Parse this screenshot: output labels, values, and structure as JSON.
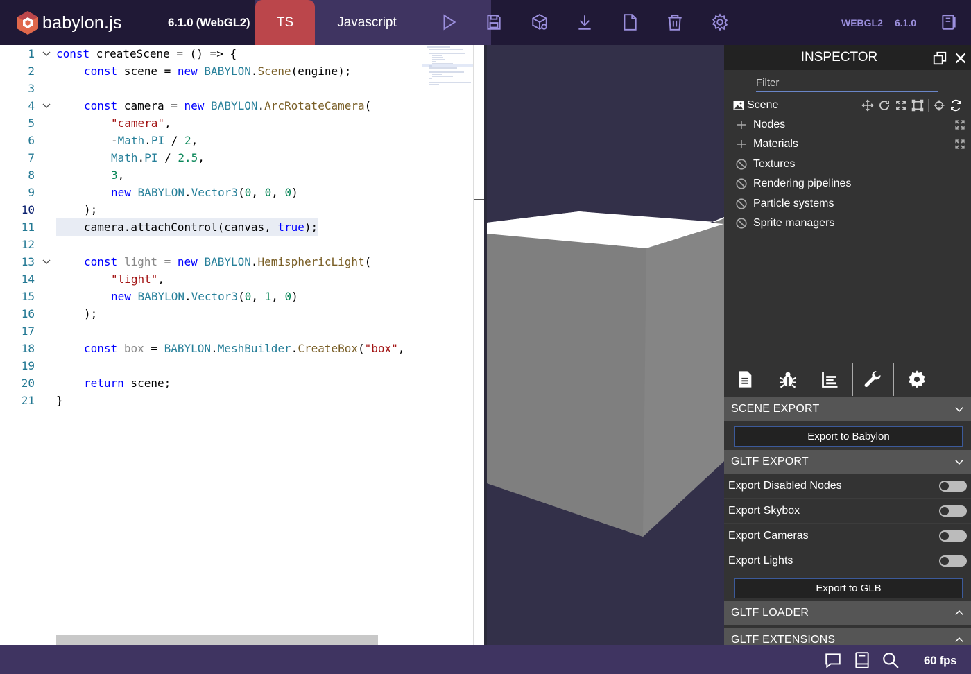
{
  "header": {
    "logo_text": "babylon.js",
    "version_label": "6.1.0 (WebGL2)",
    "tab_ts": "TS",
    "tab_js": "Javascript",
    "engine_label": "WEBGL2",
    "version_short": "6.1.0",
    "icons": [
      "play-icon",
      "save-icon",
      "inspector-cube-icon",
      "download-icon",
      "new-file-icon",
      "delete-icon",
      "settings-icon",
      "examples-icon"
    ]
  },
  "editor": {
    "lines": [
      {
        "n": "1",
        "fold": true
      },
      {
        "n": "2",
        "fold": false
      },
      {
        "n": "3",
        "fold": false
      },
      {
        "n": "4",
        "fold": true
      },
      {
        "n": "5",
        "fold": false
      },
      {
        "n": "6",
        "fold": false
      },
      {
        "n": "7",
        "fold": false
      },
      {
        "n": "8",
        "fold": false
      },
      {
        "n": "9",
        "fold": false
      },
      {
        "n": "10",
        "fold": false
      },
      {
        "n": "11",
        "fold": false
      },
      {
        "n": "12",
        "fold": false
      },
      {
        "n": "13",
        "fold": true
      },
      {
        "n": "14",
        "fold": false
      },
      {
        "n": "15",
        "fold": false
      },
      {
        "n": "16",
        "fold": false
      },
      {
        "n": "17",
        "fold": false
      },
      {
        "n": "18",
        "fold": false
      },
      {
        "n": "19",
        "fold": false
      },
      {
        "n": "20",
        "fold": false
      },
      {
        "n": "21",
        "fold": false
      }
    ],
    "code": {
      "l1": [
        "const",
        " createScene = () => {"
      ],
      "l2": [
        "const",
        " scene = ",
        "new",
        " ",
        "BABYLON",
        ".",
        "Scene",
        "(engine);"
      ],
      "l4": [
        "const",
        " camera = ",
        "new",
        " ",
        "BABYLON",
        ".",
        "ArcRotateCamera",
        "("
      ],
      "l5": [
        "\"camera\"",
        ","
      ],
      "l6": [
        "-",
        "Math",
        ".",
        "PI",
        " / ",
        "2",
        ","
      ],
      "l7": [
        "Math",
        ".",
        "PI",
        " / ",
        "2.5",
        ","
      ],
      "l8": [
        "3",
        ","
      ],
      "l9": [
        "new",
        " ",
        "BABYLON",
        ".",
        "Vector3",
        "(",
        "0",
        ", ",
        "0",
        ", ",
        "0",
        ")"
      ],
      "l10": [
        ");"
      ],
      "l11": [
        "camera.attachControl(canvas, ",
        "true",
        ");"
      ],
      "l13": [
        "const",
        " ",
        "light",
        " = ",
        "new",
        " ",
        "BABYLON",
        ".",
        "HemisphericLight",
        "("
      ],
      "l14": [
        "\"light\"",
        ","
      ],
      "l15": [
        "new",
        " ",
        "BABYLON",
        ".",
        "Vector3",
        "(",
        "0",
        ", ",
        "1",
        ", ",
        "0",
        ")"
      ],
      "l16": [
        ");"
      ],
      "l18": [
        "const",
        " ",
        "box",
        " = ",
        "BABYLON",
        ".",
        "MeshBuilder",
        ".",
        "CreateBox",
        "(",
        "\"box\"",
        ","
      ],
      "l20": [
        "return",
        " scene;"
      ],
      "l21": [
        "}"
      ]
    }
  },
  "inspector": {
    "title": "INSPECTOR",
    "filter_placeholder": "Filter",
    "tree": [
      {
        "label": "Scene",
        "icon": "image-icon"
      },
      {
        "label": "Nodes",
        "icon": "plus-icon"
      },
      {
        "label": "Materials",
        "icon": "plus-icon"
      },
      {
        "label": "Textures",
        "icon": "ban-icon"
      },
      {
        "label": "Rendering pipelines",
        "icon": "ban-icon"
      },
      {
        "label": "Particle systems",
        "icon": "ban-icon"
      },
      {
        "label": "Sprite managers",
        "icon": "ban-icon"
      }
    ],
    "tabs": [
      "properties-icon",
      "debug-icon",
      "statistics-icon",
      "tools-icon",
      "settings-icon"
    ],
    "active_tab": "tools-icon",
    "sections": {
      "scene_export": "SCENE EXPORT",
      "export_babylon": "Export to Babylon",
      "gltf_export": "GLTF EXPORT",
      "toggles": [
        {
          "label": "Export Disabled Nodes",
          "on": false
        },
        {
          "label": "Export Skybox",
          "on": false
        },
        {
          "label": "Export Cameras",
          "on": false
        },
        {
          "label": "Export Lights",
          "on": false
        }
      ],
      "export_glb": "Export to GLB",
      "gltf_loader": "GLTF LOADER",
      "gltf_extensions": "GLTF EXTENSIONS"
    }
  },
  "footer": {
    "fps": "60 fps",
    "icons": [
      "feedback-icon",
      "docs-icon",
      "search-icon"
    ]
  },
  "colors": {
    "topbar": "#201936",
    "ts_tab": "#bb464b",
    "lang_bg": "#3f3461",
    "canvas_bg": "#333049",
    "inspector_bg": "#333333"
  }
}
